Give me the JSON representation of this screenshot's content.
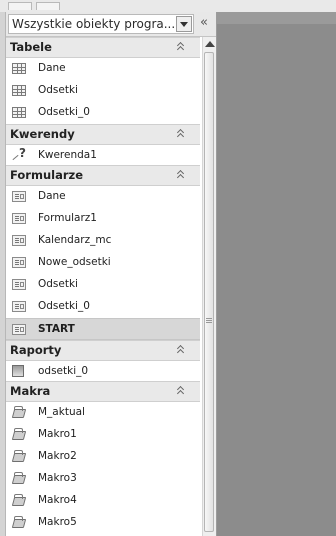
{
  "pane": {
    "title": "Wszystkie obiekty progra...",
    "collapse_glyph": "«"
  },
  "groups": [
    {
      "title": "Tabele",
      "items": [
        {
          "label": "Dane",
          "icon": "table-icon"
        },
        {
          "label": "Odsetki",
          "icon": "table-icon"
        },
        {
          "label": "Odsetki_0",
          "icon": "table-icon"
        }
      ]
    },
    {
      "title": "Kwerendy",
      "items": [
        {
          "label": "Kwerenda1",
          "icon": "query-icon"
        }
      ]
    },
    {
      "title": "Formularze",
      "items": [
        {
          "label": "Dane",
          "icon": "form-icon"
        },
        {
          "label": "Formularz1",
          "icon": "form-icon"
        },
        {
          "label": "Kalendarz_mc",
          "icon": "form-icon"
        },
        {
          "label": "Nowe_odsetki",
          "icon": "form-icon"
        },
        {
          "label": "Odsetki",
          "icon": "form-icon"
        },
        {
          "label": "Odsetki_0",
          "icon": "form-icon"
        },
        {
          "label": "START",
          "icon": "form-icon",
          "selected": true
        }
      ]
    },
    {
      "title": "Raporty",
      "items": [
        {
          "label": "odsetki_0",
          "icon": "report-icon"
        }
      ]
    },
    {
      "title": "Makra",
      "items": [
        {
          "label": "M_aktual",
          "icon": "macro-icon"
        },
        {
          "label": "Makro1",
          "icon": "macro-icon"
        },
        {
          "label": "Makro2",
          "icon": "macro-icon"
        },
        {
          "label": "Makro3",
          "icon": "macro-icon"
        },
        {
          "label": "Makro4",
          "icon": "macro-icon"
        },
        {
          "label": "Makro5",
          "icon": "macro-icon"
        }
      ]
    }
  ]
}
